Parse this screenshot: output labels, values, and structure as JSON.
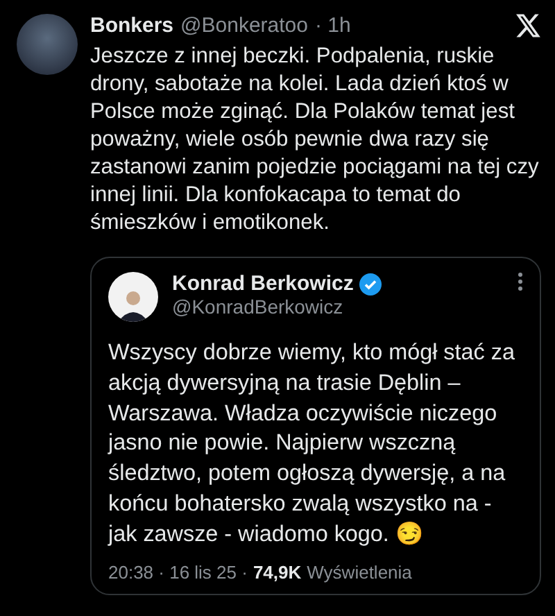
{
  "post": {
    "author": "Bonkers",
    "handle": "@Bonkeratoo",
    "time": "· 1h",
    "text": "Jeszcze z innej beczki. Podpalenia, ruskie drony, sabotaże na kolei. Lada dzień ktoś w Polsce może zginąć. Dla Polaków temat jest poważny, wiele osób pewnie dwa razy się zastanowi zanim pojedzie pociągami na tej czy innej linii. Dla konfokacapa to temat do śmieszków i emotikonek."
  },
  "quote": {
    "author": "Konrad Berkowicz",
    "verified": true,
    "handle": "@KonradBerkowicz",
    "text": "Wszyscy dobrze wiemy, kto mógł stać za akcją dywersyjną na trasie Dęblin –Warszawa. Władza oczywiście niczego jasno nie powie. Najpierw wszczną śledztwo, potem ogłoszą dywersję, a na końcu bohatersko zwalą wszystko na - jak zawsze - wiadomo kogo. 😏",
    "time": "20:38 · 16 lis 25 ·",
    "views": "74,9K",
    "views_label": "Wyświetlenia"
  }
}
